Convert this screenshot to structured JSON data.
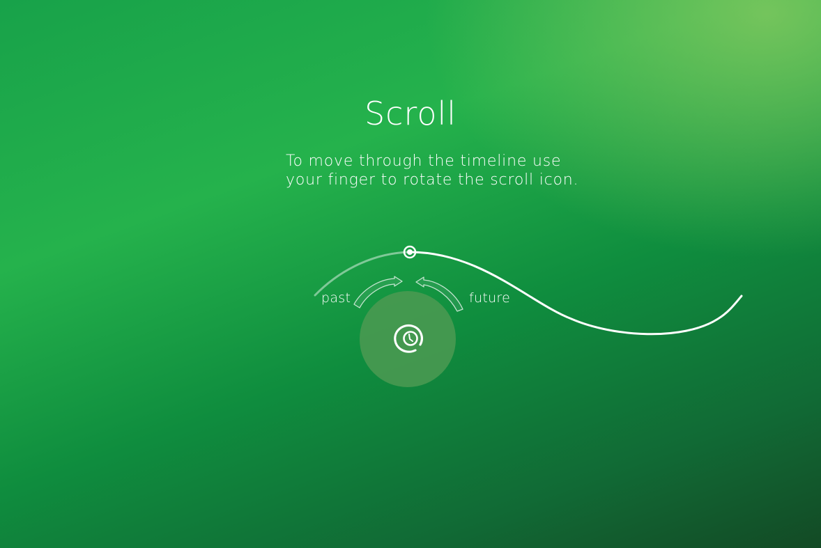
{
  "screen": {
    "title": "Scroll",
    "instruction_line1": "To move through the timeline use",
    "instruction_line2": "your finger to rotate the scroll icon."
  },
  "timeline": {
    "past_label": "past",
    "future_label": "future",
    "handle_icon": "scroll-icon",
    "marker_icon": "timeline-position-marker-icon",
    "arrow_icons": [
      "arrow-toward-future-icon",
      "arrow-toward-past-icon"
    ]
  },
  "colors": {
    "background_top": "#25b24c",
    "background_highlight": "#82c85f",
    "background_bottom": "#134a25",
    "line": "#ffffff",
    "dial_fill": "#4c9a52"
  }
}
